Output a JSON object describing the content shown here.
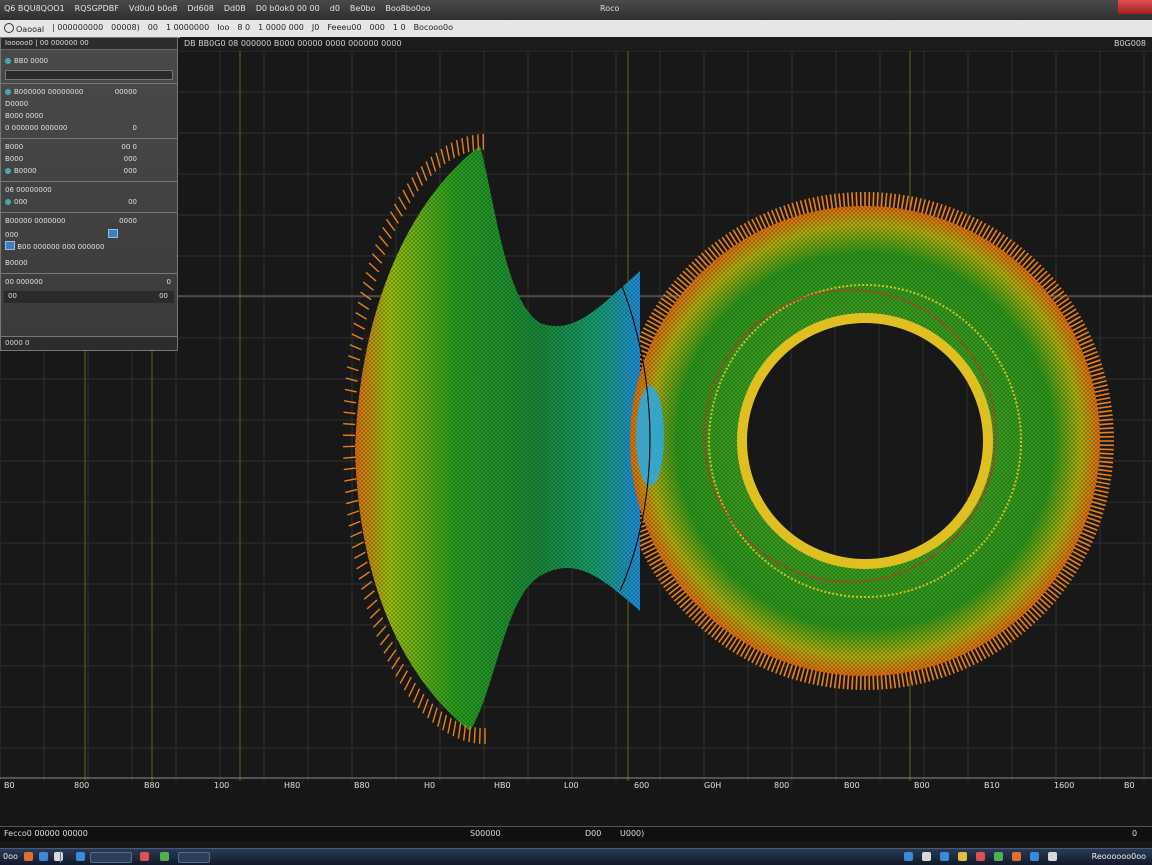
{
  "titlebar": {
    "menu": [
      "Q6 BQU8QOO1",
      "RQSGPDBF",
      "Vd0u0 b0o8",
      "Dd608",
      "Dd0B",
      "D0 b0ok0 00 00",
      "d0",
      "Be0bo",
      "Boo8bo0oo"
    ],
    "window_title": "Roco"
  },
  "toolbar": {
    "items": [
      "Oaooal",
      "| 000000000",
      "00008)",
      "00",
      "1 0000000",
      "Ioo",
      "8 0",
      "1 0000 000",
      "J0",
      "Feeeu00",
      "000",
      "1 0",
      "Bocooo0o"
    ]
  },
  "subbar": {
    "text": "DB BB0G0 08 000000 B000 00000 0000  000000 0000",
    "right": "B0G008"
  },
  "panel": {
    "header": "Iooooo0 | 00 000000  00",
    "rows": [
      {
        "label": "BB0 0000",
        "value": ""
      },
      {
        "label": "B000000 00000000",
        "value": "00000"
      },
      {
        "label": "D0000",
        "value": ""
      },
      {
        "label": "B000 0000",
        "value": ""
      },
      {
        "label": "0 000000 000000",
        "value": "0"
      },
      {
        "label": "B000",
        "value": "00 0"
      },
      {
        "label": "B000",
        "value": "000"
      },
      {
        "label": "B0000",
        "value": "000"
      },
      {
        "label": "06 00000000",
        "value": ""
      },
      {
        "label": "000",
        "value": "00"
      },
      {
        "label": "B00000 0000000",
        "value": "0000"
      },
      {
        "label": "000",
        "value": ""
      },
      {
        "label": "B00 000000 000 000000",
        "value": ""
      },
      {
        "label": "B0000",
        "value": ""
      },
      {
        "label": "00 000000",
        "value": "0"
      },
      {
        "label": "00",
        "value": "00"
      }
    ],
    "footer": "0000 0"
  },
  "x_ticks": [
    "B0",
    "800",
    "B80",
    "100",
    "H80",
    "B80",
    "H0",
    "HB0",
    "L00",
    "600",
    "G0H",
    "800",
    "B00",
    "B00",
    "B10",
    "1600",
    "B0"
  ],
  "statusbar": {
    "left": "Fecco0 00000 00000",
    "center": "S00000",
    "mid": "D00",
    "mid2": "U000)",
    "right": "0"
  },
  "taskbar": {
    "start": "0oo",
    "clock": "Reoooooo0oo",
    "colors": [
      "#e07030",
      "#3a8ad8",
      "#d8d8d8",
      "#3a8ad8",
      "#e0c040",
      "#e05050",
      "#50b050"
    ]
  }
}
